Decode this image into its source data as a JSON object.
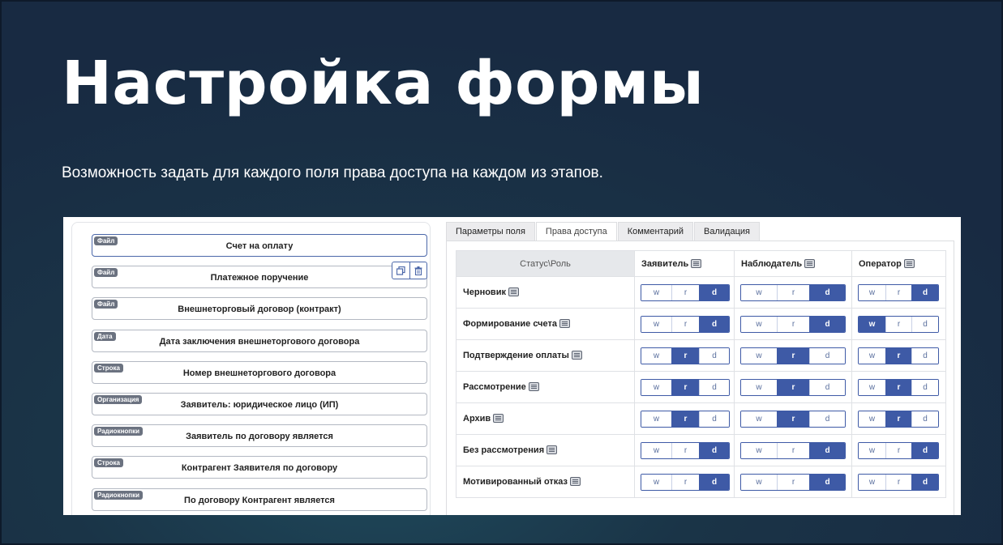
{
  "slide": {
    "title": "Настройка формы",
    "subtitle": "Возможность задать для каждого поля права доступа на каждом из этапов."
  },
  "fields": [
    {
      "type": "Файл",
      "name": "Счет на оплату",
      "selected": true
    },
    {
      "type": "Файл",
      "name": "Платежное поручение",
      "selected": false
    },
    {
      "type": "Файл",
      "name": "Внешнеторговый договор (контракт)",
      "selected": false
    },
    {
      "type": "Дата",
      "name": "Дата заключения внешнеторгового договора",
      "selected": false
    },
    {
      "type": "Строка",
      "name": "Номер внешнеторгового договора",
      "selected": false
    },
    {
      "type": "Организация",
      "name": "Заявитель: юридическое лицо (ИП)",
      "selected": false
    },
    {
      "type": "Радиокнопки",
      "name": "Заявитель по договору является",
      "selected": false
    },
    {
      "type": "Строка",
      "name": "Контрагент Заявителя по договору",
      "selected": false
    },
    {
      "type": "Радиокнопки",
      "name": "По договору Контрагент является",
      "selected": false
    }
  ],
  "field_actions": [
    {
      "icon": "copy-icon"
    },
    {
      "icon": "trash-icon"
    }
  ],
  "tabs": [
    {
      "label": "Параметры поля",
      "active": false
    },
    {
      "label": "Права доступа",
      "active": true
    },
    {
      "label": "Комментарий",
      "active": false
    },
    {
      "label": "Валидация",
      "active": false
    }
  ],
  "permissions": {
    "corner_label": "Статус\\Роль",
    "options": [
      "w",
      "r",
      "d"
    ],
    "roles": [
      "Заявитель",
      "Наблюдатель",
      "Оператор"
    ],
    "rows": [
      {
        "stage": "Черновик",
        "selected": [
          "d",
          "d",
          "d"
        ]
      },
      {
        "stage": "Формирование счета",
        "selected": [
          "d",
          "d",
          "w"
        ]
      },
      {
        "stage": "Подтверждение оплаты",
        "selected": [
          "r",
          "r",
          "r"
        ]
      },
      {
        "stage": "Рассмотрение",
        "selected": [
          "r",
          "r",
          "r"
        ]
      },
      {
        "stage": "Архив",
        "selected": [
          "r",
          "r",
          "r"
        ]
      },
      {
        "stage": "Без рассмотрения",
        "selected": [
          "d",
          "d",
          "d"
        ]
      },
      {
        "stage": "Мотивированный отказ",
        "selected": [
          "d",
          "d",
          "d"
        ]
      }
    ]
  },
  "colors": {
    "accent": "#3e5aa6",
    "background": "#1a3447",
    "tag": "#6b7280"
  }
}
